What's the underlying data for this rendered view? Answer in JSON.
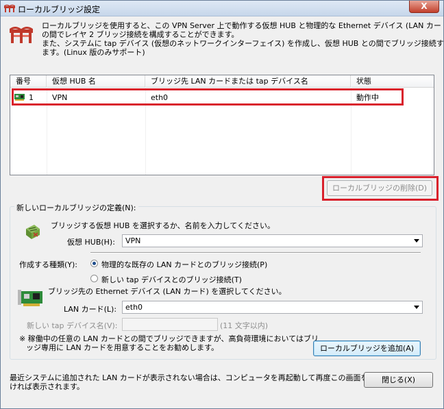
{
  "window": {
    "title": "ローカルブリッジ設定",
    "close_label": "X"
  },
  "intro": {
    "line1": "ローカルブリッジを使用すると、この VPN Server 上で動作する仮想 HUB と物理的な Ethernet デバイス (LAN カード) と",
    "line2": "の間でレイヤ 2 ブリッジ接続を構成することができます。",
    "line3": "また、システムに tap デバイス (仮想のネットワークインターフェイス) を作成し、仮想 HUB との間でブリッジ接続することもでき",
    "line4": "ます。(Linux 版のみサポート)"
  },
  "table": {
    "columns": [
      "番号",
      "仮想 HUB 名",
      "ブリッジ先 LAN カードまたは tap デバイス名",
      "状態"
    ],
    "rows": [
      {
        "num": "1",
        "hub": "VPN",
        "device": "eth0",
        "status": "動作中"
      }
    ]
  },
  "delete_button": "ローカルブリッジの削除(D)",
  "new_bridge": {
    "group_label": "新しいローカルブリッジの定義(N):",
    "hub_prompt": "ブリッジする仮想 HUB を選択するか、名前を入力してください。",
    "hub_label": "仮想 HUB(H):",
    "hub_value": "VPN",
    "type_label": "作成する種類(Y):",
    "radio_physical": "物理的な既存の LAN カードとのブリッジ接続(P)",
    "radio_tap": "新しい tap デバイスとのブリッジ接続(T)",
    "device_prompt_1": "ブリッジ先の Ethernet デバイス (LAN カード) を選択してください。",
    "lan_label": "LAN カード(L):",
    "lan_value": "eth0",
    "tap_label": "新しい tap デバイス名(V):",
    "tap_hint": "(11 文字以内)",
    "note_1": "※ 稼働中の任意の LAN カードとの間でブリッジできますが、高負荷環境においてはブリ",
    "note_2": "ッジ専用に LAN カードを用意することをお勧めします。",
    "add_button": "ローカルブリッジを追加(A)"
  },
  "footer": {
    "note_1": "最近システムに追加された LAN カードが表示されない場合は、コンピュータを再起動して再度この画面を開",
    "note_2": "ければ表示されます。",
    "close_button": "閉じる(X)"
  },
  "colors": {
    "highlight": "#d9202c",
    "title_bar": "#c6d6ea",
    "close_button": "#c2402c"
  }
}
